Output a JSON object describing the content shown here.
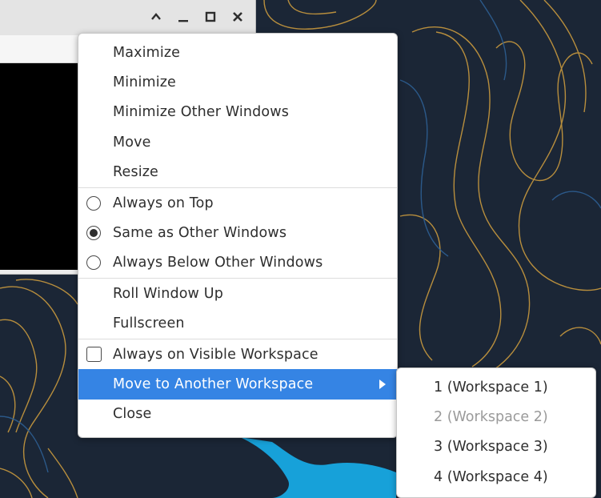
{
  "window": {
    "titlebar_icons": [
      "chevron-up-icon",
      "minimize-icon",
      "maximize-icon",
      "close-icon"
    ]
  },
  "menu": {
    "group1": [
      "Maximize",
      "Minimize",
      "Minimize Other Windows",
      "Move",
      "Resize"
    ],
    "layer": {
      "options": [
        "Always on Top",
        "Same as Other Windows",
        "Always Below Other Windows"
      ],
      "selected": "Same as Other Windows"
    },
    "group3": [
      "Roll Window Up",
      "Fullscreen"
    ],
    "visible_workspace": {
      "label": "Always on Visible Workspace",
      "checked": false
    },
    "move_workspace": "Move to Another Workspace",
    "close": "Close"
  },
  "submenu": {
    "items": [
      {
        "label": "1 (Workspace 1)",
        "enabled": true
      },
      {
        "label": "2 (Workspace 2)",
        "enabled": false
      },
      {
        "label": "3 (Workspace 3)",
        "enabled": true
      },
      {
        "label": "4 (Workspace 4)",
        "enabled": true
      }
    ]
  },
  "colors": {
    "highlight": "#3584e4",
    "desktop": "#1b2636",
    "contour_gold": "#c99a3e",
    "contour_blue": "#2d5f93",
    "blob": "#17a1d9"
  }
}
